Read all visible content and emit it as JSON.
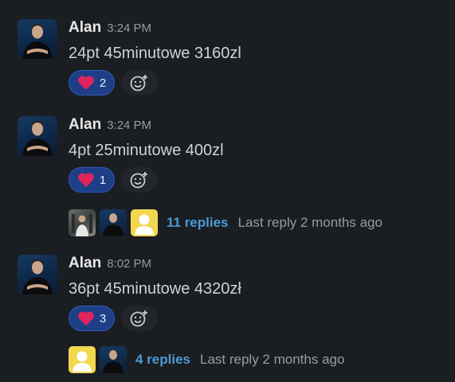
{
  "messages": [
    {
      "author": "Alan",
      "time": "3:24 PM",
      "text": "24pt 45minutowe 3160zl",
      "reaction": {
        "emoji": "heart",
        "count": "2"
      }
    },
    {
      "author": "Alan",
      "time": "3:24 PM",
      "text": "4pt 25minutowe 400zl",
      "reaction": {
        "emoji": "heart",
        "count": "1"
      },
      "thread": {
        "replies": "11 replies",
        "last_reply": "Last reply 2 months ago"
      }
    },
    {
      "author": "Alan",
      "time": "8:02 PM",
      "text": "36pt 45minutowe 4320zł",
      "reaction": {
        "emoji": "heart",
        "count": "3"
      },
      "thread": {
        "replies": "4 replies",
        "last_reply": "Last reply 2 months ago"
      }
    }
  ],
  "colors": {
    "background": "#1a1d21",
    "reaction_bg": "#1e3f86",
    "link": "#4b9cd8",
    "heart": "#e0245e"
  },
  "icons": [
    "heart-icon",
    "add-reaction-icon",
    "avatar"
  ]
}
